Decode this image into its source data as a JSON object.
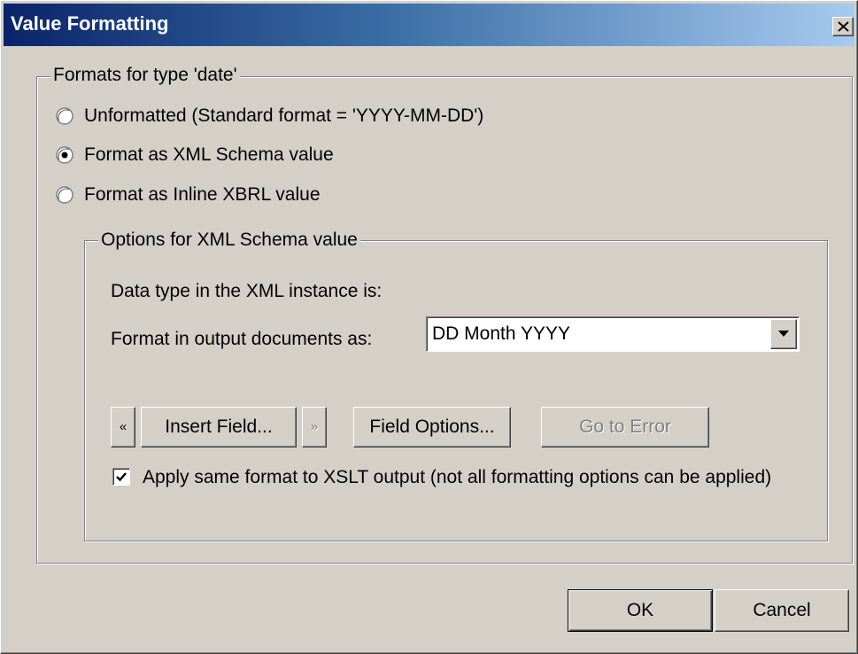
{
  "window": {
    "title": "Value Formatting",
    "close_icon": "close-icon"
  },
  "formats_group": {
    "label": "Formats for type 'date'",
    "options": [
      {
        "label": "Unformatted (Standard format = 'YYYY-MM-DD')",
        "selected": false
      },
      {
        "label": "Format as XML Schema value",
        "selected": true
      },
      {
        "label": "Format as Inline XBRL value",
        "selected": false
      }
    ]
  },
  "options_group": {
    "label": "Options for XML Schema value",
    "data_type_label": "Data type in the XML instance is:",
    "format_label": "Format in output documents as:",
    "format_value": "DD Month YYYY",
    "dropdown_icon": "chevron-down-icon",
    "prev_label": "«",
    "insert_field_label": "Insert Field...",
    "next_label": "»",
    "field_options_label": "Field Options...",
    "go_to_error_label": "Go to Error",
    "apply_xslt_label": "Apply same format to XSLT output (not all formatting options can be applied)",
    "apply_xslt_checked": true
  },
  "footer": {
    "ok_label": "OK",
    "cancel_label": "Cancel"
  },
  "colors": {
    "face": "#d4d0c8",
    "title_start": "#0a246a",
    "title_end": "#a6caf0"
  }
}
